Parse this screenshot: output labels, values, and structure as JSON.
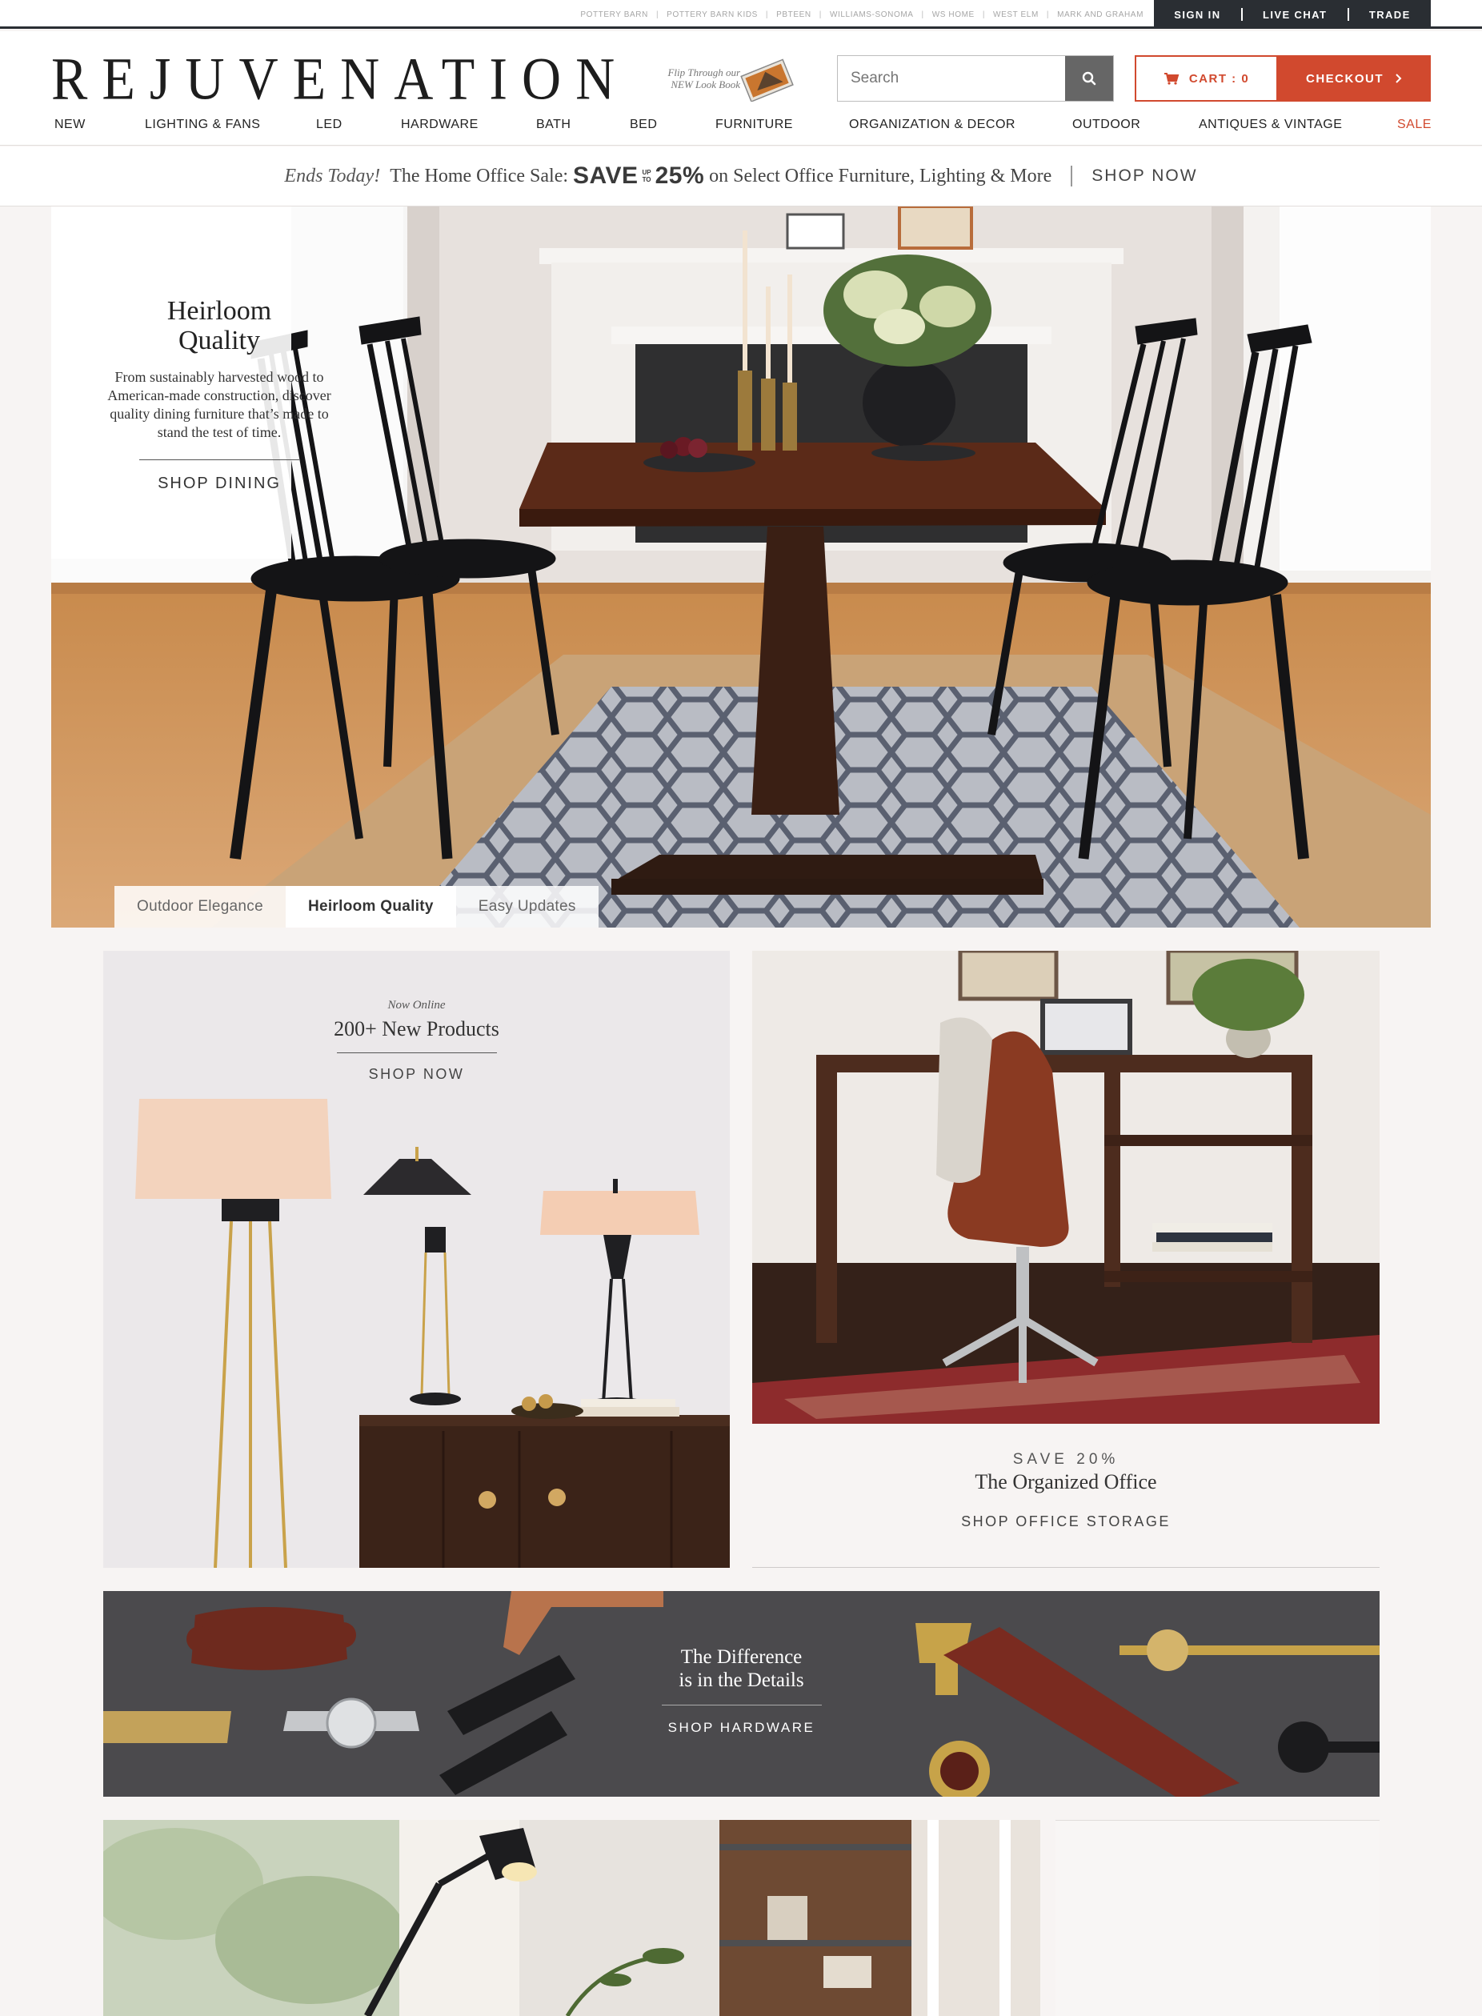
{
  "utility": {
    "family_links": [
      "POTTERY BARN",
      "POTTERY BARN KIDS",
      "PBTEEN",
      "WILLIAMS-SONOMA",
      "WS HOME",
      "WEST ELM",
      "MARK AND GRAHAM"
    ],
    "account_links": [
      "SIGN IN",
      "LIVE CHAT",
      "TRADE"
    ]
  },
  "header": {
    "logo": "REJUVENATION",
    "lookbook": {
      "line1": "Flip Through our",
      "line2": "NEW Look Book"
    },
    "search": {
      "placeholder": "Search",
      "icon": "search-icon"
    },
    "cart_label": "CART : 0",
    "checkout_label": "CHECKOUT"
  },
  "nav": [
    "NEW",
    "LIGHTING & FANS",
    "LED",
    "HARDWARE",
    "BATH",
    "BED",
    "FURNITURE",
    "ORGANIZATION & DECOR",
    "OUTDOOR",
    "ANTIQUES & VINTAGE",
    "SALE"
  ],
  "promo": {
    "lead": "Ends Today!",
    "name": "The Home Office Sale:",
    "save": "SAVE",
    "up": "UP",
    "to": "TO",
    "pct": "25%",
    "rest": "on Select Office Furniture, Lighting & More",
    "cta": "SHOP NOW"
  },
  "hero": {
    "title_line1": "Heirloom",
    "title_line2": "Quality",
    "body": "From sustainably harvested wood to American-made construction, discover quality dining furniture that’s made to stand the test of time.",
    "cta": "SHOP DINING",
    "tabs": [
      "Outdoor Elegance",
      "Heirloom Quality",
      "Easy Updates"
    ],
    "active_tab": 1
  },
  "tiles": {
    "new_products": {
      "kicker": "Now Online",
      "headline": "200+ New Products",
      "cta": "SHOP NOW"
    },
    "office": {
      "kicker": "SAVE 20%",
      "headline": "The Organized Office",
      "cta": "SHOP OFFICE STORAGE"
    },
    "hardware": {
      "line1": "The Difference",
      "line2": "is in the Details",
      "cta": "SHOP HARDWARE"
    }
  },
  "colors": {
    "accent": "#d1492e",
    "dark_bar": "#2a2e33",
    "page_bg": "#f7f4f3"
  }
}
